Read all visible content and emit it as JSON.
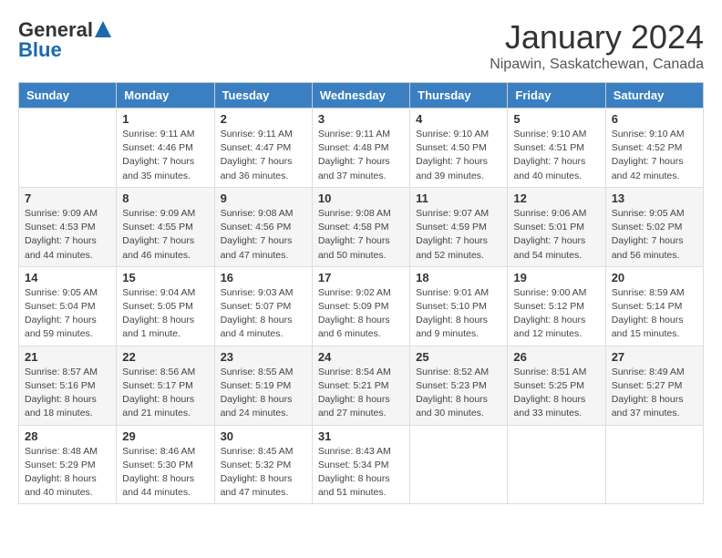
{
  "header": {
    "logo_general": "General",
    "logo_blue": "Blue",
    "month_title": "January 2024",
    "location": "Nipawin, Saskatchewan, Canada"
  },
  "days_of_week": [
    "Sunday",
    "Monday",
    "Tuesday",
    "Wednesday",
    "Thursday",
    "Friday",
    "Saturday"
  ],
  "weeks": [
    [
      {
        "day": "",
        "info": ""
      },
      {
        "day": "1",
        "info": "Sunrise: 9:11 AM\nSunset: 4:46 PM\nDaylight: 7 hours\nand 35 minutes."
      },
      {
        "day": "2",
        "info": "Sunrise: 9:11 AM\nSunset: 4:47 PM\nDaylight: 7 hours\nand 36 minutes."
      },
      {
        "day": "3",
        "info": "Sunrise: 9:11 AM\nSunset: 4:48 PM\nDaylight: 7 hours\nand 37 minutes."
      },
      {
        "day": "4",
        "info": "Sunrise: 9:10 AM\nSunset: 4:50 PM\nDaylight: 7 hours\nand 39 minutes."
      },
      {
        "day": "5",
        "info": "Sunrise: 9:10 AM\nSunset: 4:51 PM\nDaylight: 7 hours\nand 40 minutes."
      },
      {
        "day": "6",
        "info": "Sunrise: 9:10 AM\nSunset: 4:52 PM\nDaylight: 7 hours\nand 42 minutes."
      }
    ],
    [
      {
        "day": "7",
        "info": "Sunrise: 9:09 AM\nSunset: 4:53 PM\nDaylight: 7 hours\nand 44 minutes."
      },
      {
        "day": "8",
        "info": "Sunrise: 9:09 AM\nSunset: 4:55 PM\nDaylight: 7 hours\nand 46 minutes."
      },
      {
        "day": "9",
        "info": "Sunrise: 9:08 AM\nSunset: 4:56 PM\nDaylight: 7 hours\nand 47 minutes."
      },
      {
        "day": "10",
        "info": "Sunrise: 9:08 AM\nSunset: 4:58 PM\nDaylight: 7 hours\nand 50 minutes."
      },
      {
        "day": "11",
        "info": "Sunrise: 9:07 AM\nSunset: 4:59 PM\nDaylight: 7 hours\nand 52 minutes."
      },
      {
        "day": "12",
        "info": "Sunrise: 9:06 AM\nSunset: 5:01 PM\nDaylight: 7 hours\nand 54 minutes."
      },
      {
        "day": "13",
        "info": "Sunrise: 9:05 AM\nSunset: 5:02 PM\nDaylight: 7 hours\nand 56 minutes."
      }
    ],
    [
      {
        "day": "14",
        "info": "Sunrise: 9:05 AM\nSunset: 5:04 PM\nDaylight: 7 hours\nand 59 minutes."
      },
      {
        "day": "15",
        "info": "Sunrise: 9:04 AM\nSunset: 5:05 PM\nDaylight: 8 hours\nand 1 minute."
      },
      {
        "day": "16",
        "info": "Sunrise: 9:03 AM\nSunset: 5:07 PM\nDaylight: 8 hours\nand 4 minutes."
      },
      {
        "day": "17",
        "info": "Sunrise: 9:02 AM\nSunset: 5:09 PM\nDaylight: 8 hours\nand 6 minutes."
      },
      {
        "day": "18",
        "info": "Sunrise: 9:01 AM\nSunset: 5:10 PM\nDaylight: 8 hours\nand 9 minutes."
      },
      {
        "day": "19",
        "info": "Sunrise: 9:00 AM\nSunset: 5:12 PM\nDaylight: 8 hours\nand 12 minutes."
      },
      {
        "day": "20",
        "info": "Sunrise: 8:59 AM\nSunset: 5:14 PM\nDaylight: 8 hours\nand 15 minutes."
      }
    ],
    [
      {
        "day": "21",
        "info": "Sunrise: 8:57 AM\nSunset: 5:16 PM\nDaylight: 8 hours\nand 18 minutes."
      },
      {
        "day": "22",
        "info": "Sunrise: 8:56 AM\nSunset: 5:17 PM\nDaylight: 8 hours\nand 21 minutes."
      },
      {
        "day": "23",
        "info": "Sunrise: 8:55 AM\nSunset: 5:19 PM\nDaylight: 8 hours\nand 24 minutes."
      },
      {
        "day": "24",
        "info": "Sunrise: 8:54 AM\nSunset: 5:21 PM\nDaylight: 8 hours\nand 27 minutes."
      },
      {
        "day": "25",
        "info": "Sunrise: 8:52 AM\nSunset: 5:23 PM\nDaylight: 8 hours\nand 30 minutes."
      },
      {
        "day": "26",
        "info": "Sunrise: 8:51 AM\nSunset: 5:25 PM\nDaylight: 8 hours\nand 33 minutes."
      },
      {
        "day": "27",
        "info": "Sunrise: 8:49 AM\nSunset: 5:27 PM\nDaylight: 8 hours\nand 37 minutes."
      }
    ],
    [
      {
        "day": "28",
        "info": "Sunrise: 8:48 AM\nSunset: 5:29 PM\nDaylight: 8 hours\nand 40 minutes."
      },
      {
        "day": "29",
        "info": "Sunrise: 8:46 AM\nSunset: 5:30 PM\nDaylight: 8 hours\nand 44 minutes."
      },
      {
        "day": "30",
        "info": "Sunrise: 8:45 AM\nSunset: 5:32 PM\nDaylight: 8 hours\nand 47 minutes."
      },
      {
        "day": "31",
        "info": "Sunrise: 8:43 AM\nSunset: 5:34 PM\nDaylight: 8 hours\nand 51 minutes."
      },
      {
        "day": "",
        "info": ""
      },
      {
        "day": "",
        "info": ""
      },
      {
        "day": "",
        "info": ""
      }
    ]
  ]
}
